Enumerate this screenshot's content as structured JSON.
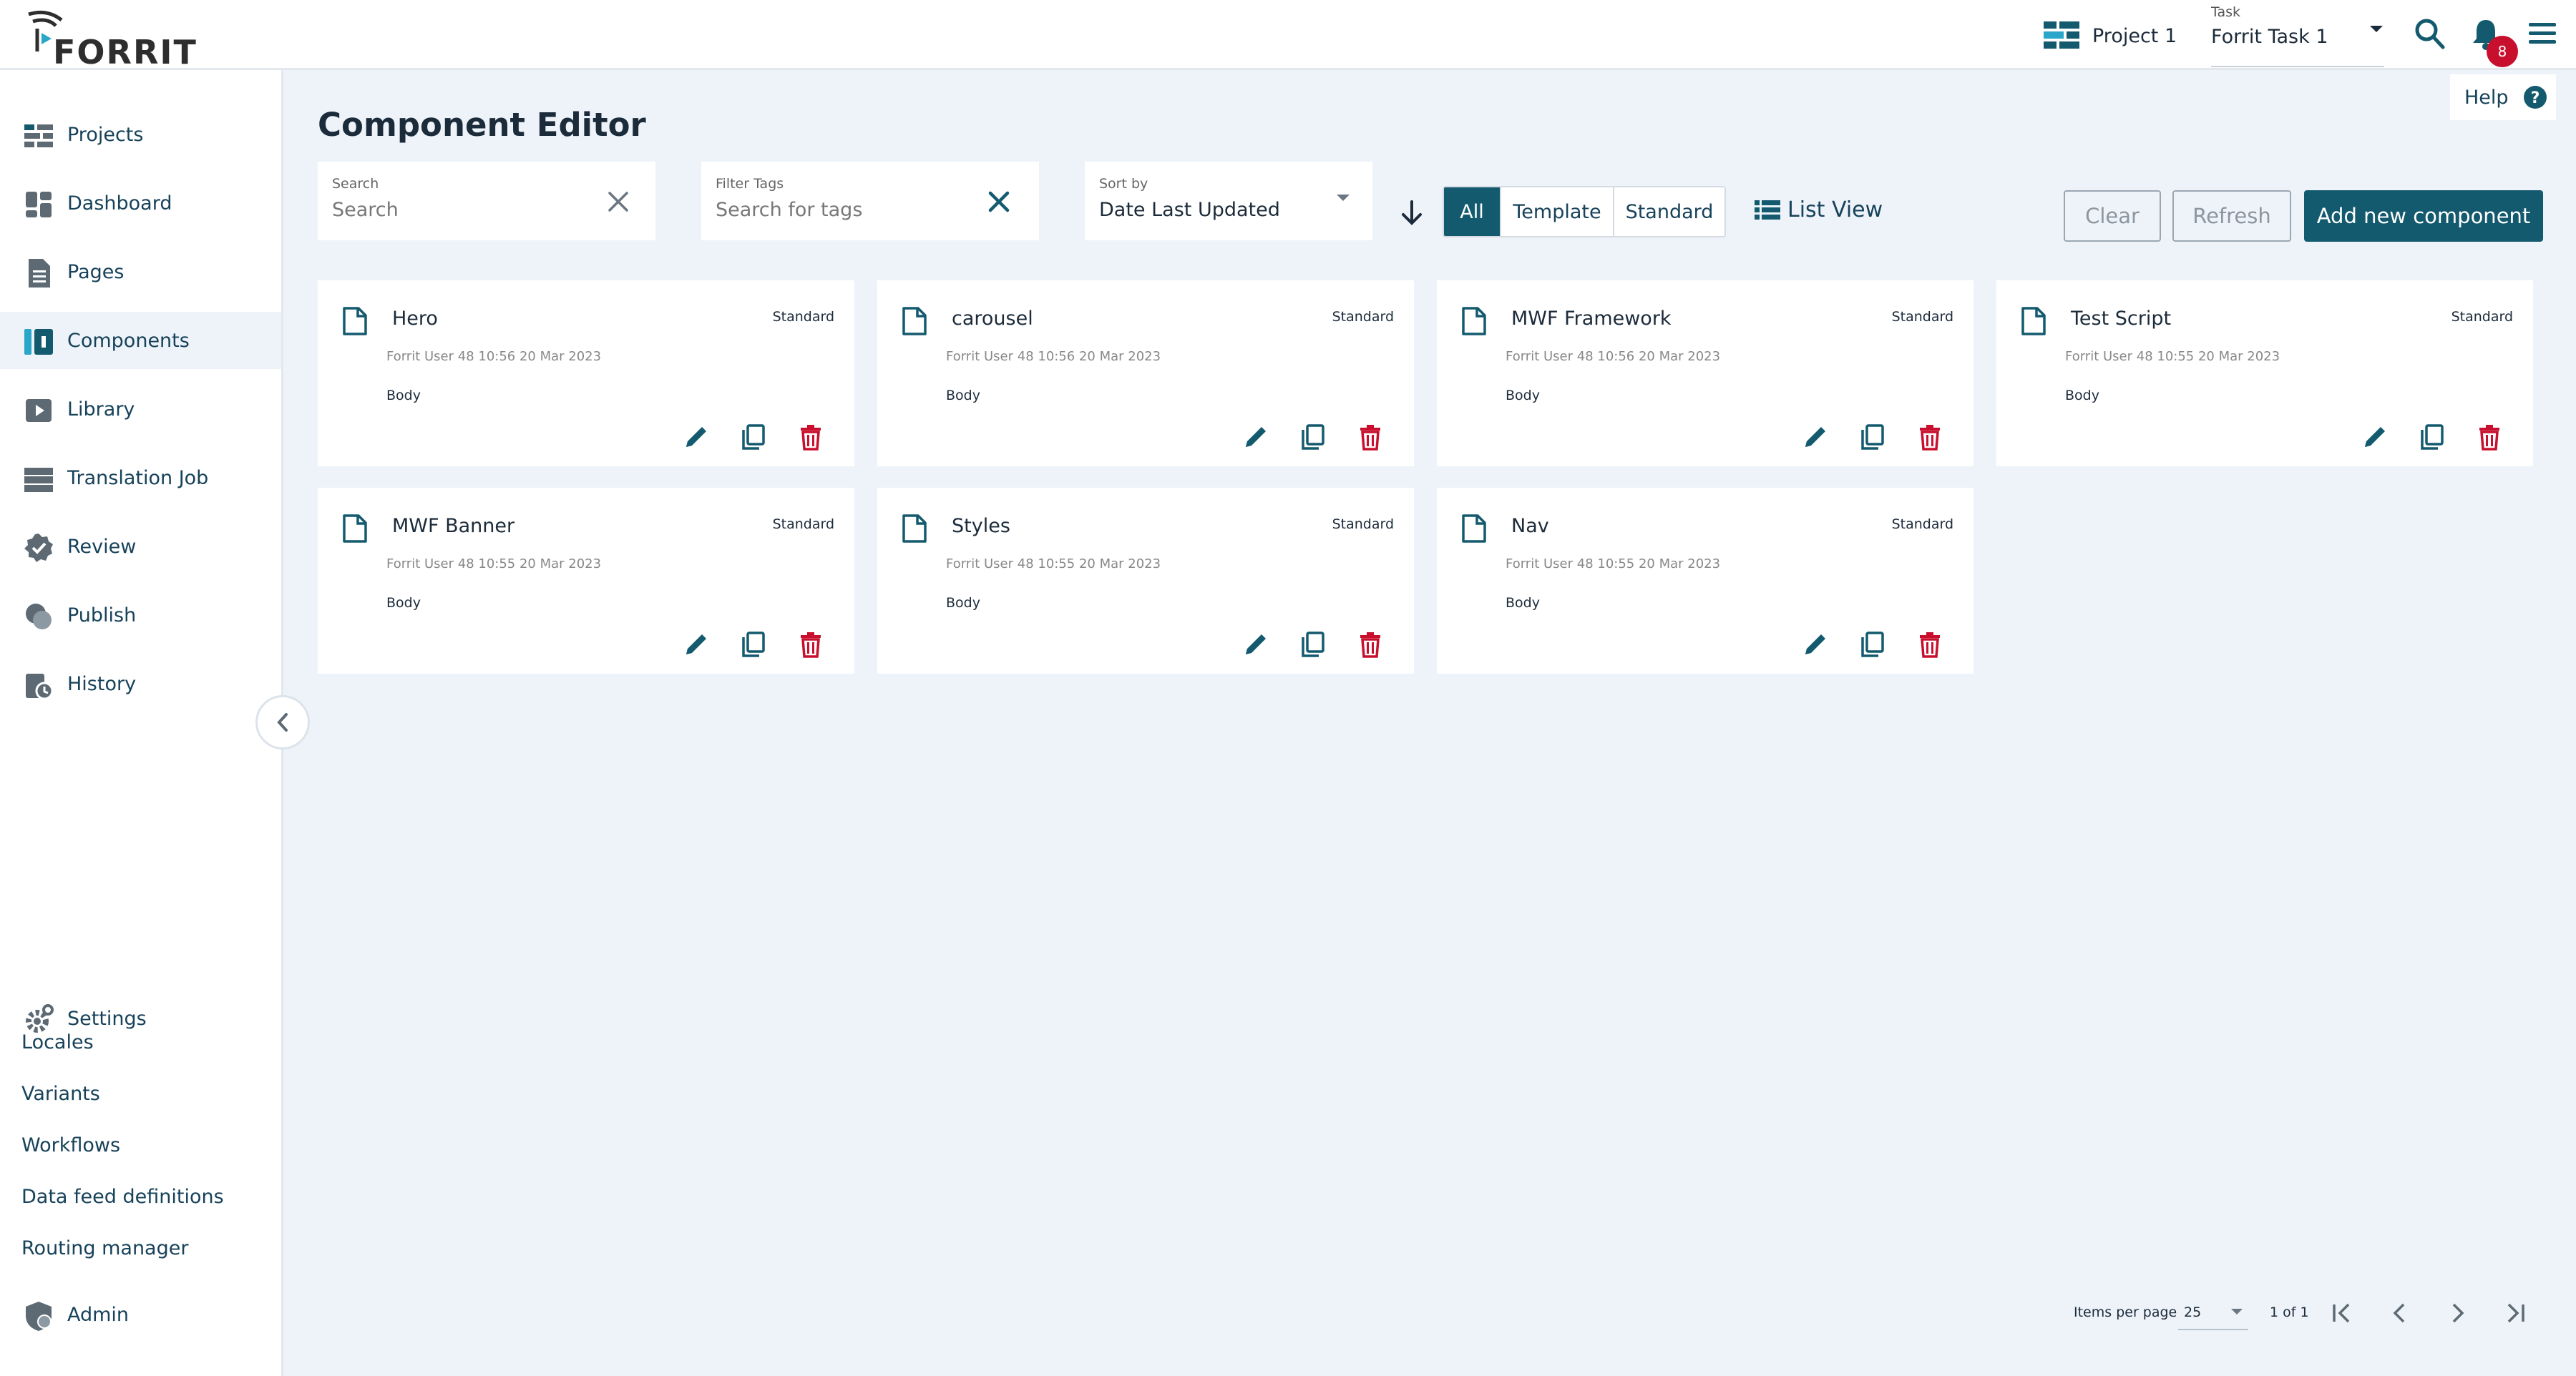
{
  "app": {
    "logo_text": "FORRIT"
  },
  "header": {
    "project_label": "Project 1",
    "task_caption": "Task",
    "task_value": "Forrit Task 1",
    "notification_count": "8"
  },
  "sidebar": {
    "items": [
      {
        "label": "Projects",
        "icon": "projects-icon"
      },
      {
        "label": "Dashboard",
        "icon": "dashboard-icon"
      },
      {
        "label": "Pages",
        "icon": "pages-icon"
      },
      {
        "label": "Components",
        "icon": "components-icon",
        "active": true
      },
      {
        "label": "Library",
        "icon": "library-icon"
      },
      {
        "label": "Translation Job",
        "icon": "translation-icon"
      },
      {
        "label": "Review",
        "icon": "review-icon"
      },
      {
        "label": "Publish",
        "icon": "publish-icon"
      },
      {
        "label": "History",
        "icon": "history-icon"
      }
    ],
    "settings_label": "Settings",
    "sub_items": [
      "Locales",
      "Variants",
      "Workflows",
      "Data feed definitions",
      "Routing manager"
    ],
    "admin_label": "Admin"
  },
  "main": {
    "title": "Component Editor",
    "help_label": "Help",
    "search": {
      "caption": "Search",
      "placeholder": "Search"
    },
    "filter_tags": {
      "caption": "Filter Tags",
      "placeholder": "Search for tags"
    },
    "sort": {
      "caption": "Sort by",
      "value": "Date Last Updated"
    },
    "segments": [
      "All",
      "Template",
      "Standard"
    ],
    "active_segment": "All",
    "list_view_label": "List View",
    "clear_label": "Clear",
    "refresh_label": "Refresh",
    "add_label": "Add new component"
  },
  "cards": [
    {
      "name": "Hero",
      "type": "Standard",
      "meta": "Forrit User 48 10:56 20 Mar 2023",
      "tag": "Body"
    },
    {
      "name": "carousel",
      "type": "Standard",
      "meta": "Forrit User 48 10:56 20 Mar 2023",
      "tag": "Body"
    },
    {
      "name": "MWF Framework",
      "type": "Standard",
      "meta": "Forrit User 48 10:56 20 Mar 2023",
      "tag": "Body"
    },
    {
      "name": "Test Script",
      "type": "Standard",
      "meta": "Forrit User 48 10:55 20 Mar 2023",
      "tag": "Body"
    },
    {
      "name": "MWF Banner",
      "type": "Standard",
      "meta": "Forrit User 48 10:55 20 Mar 2023",
      "tag": "Body"
    },
    {
      "name": "Styles",
      "type": "Standard",
      "meta": "Forrit User 48 10:55 20 Mar 2023",
      "tag": "Body"
    },
    {
      "name": "Nav",
      "type": "Standard",
      "meta": "Forrit User 48 10:55 20 Mar 2023",
      "tag": "Body"
    }
  ],
  "pagination": {
    "items_per_page_label": "Items per page",
    "items_per_page_value": "25",
    "range_label": "1 of 1"
  },
  "colors": {
    "primary": "#145a6e",
    "nav_text": "#17425a",
    "delete": "#c8102e",
    "background": "#eef3fa"
  }
}
